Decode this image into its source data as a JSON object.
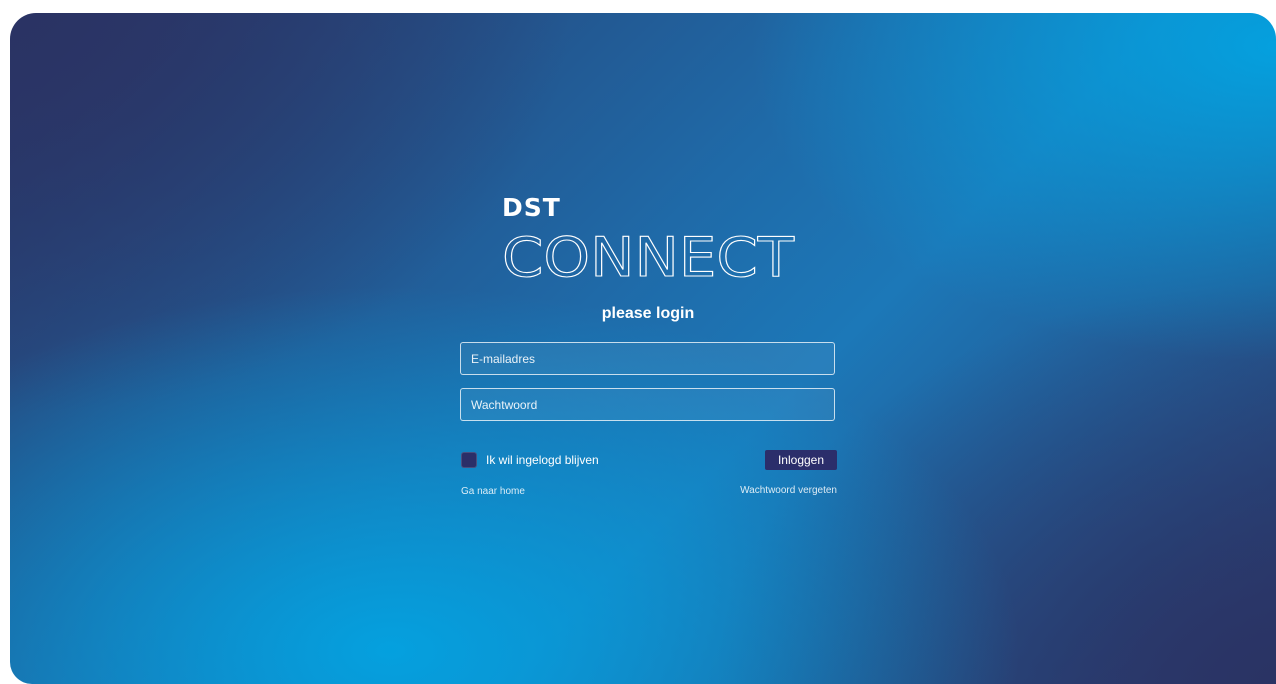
{
  "logo": {
    "line1": "DST",
    "line2": "CONNECT"
  },
  "login": {
    "heading": "please login",
    "email_placeholder": "E-mailadres",
    "password_placeholder": "Wachtwoord",
    "remember_label": "Ik wil ingelogd blijven",
    "remember_checked": false,
    "submit_label": "Inloggen",
    "home_link": "Ga naar home",
    "forgot_link": "Wachtwoord vergeten"
  },
  "colors": {
    "gradient_dark": "#2a3566",
    "gradient_light": "#03a3e1",
    "button_bg": "#2b2e6b",
    "text": "#ffffff"
  }
}
